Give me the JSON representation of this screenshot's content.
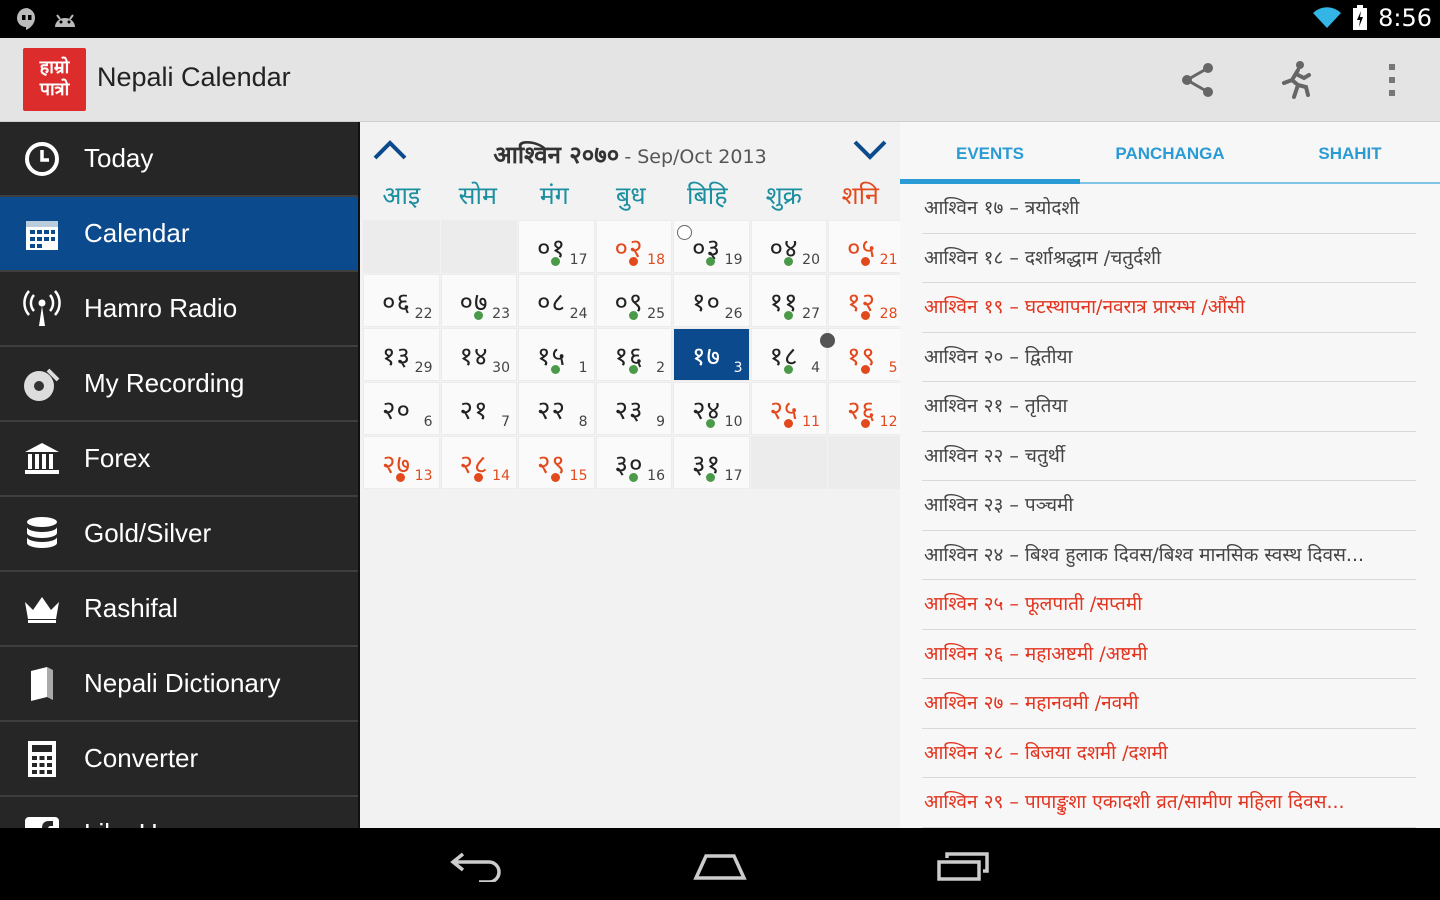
{
  "status": {
    "time": "8:56"
  },
  "app": {
    "title": "Nepali Calendar",
    "logo_line1": "हाम्रो",
    "logo_line2": "पात्रो"
  },
  "sidebar": {
    "items": [
      {
        "label": "Today",
        "icon": "clock-icon"
      },
      {
        "label": "Calendar",
        "icon": "calendar-icon",
        "active": true
      },
      {
        "label": "Hamro Radio",
        "icon": "radio-antenna-icon"
      },
      {
        "label": "My Recording",
        "icon": "record-icon"
      },
      {
        "label": "Forex",
        "icon": "bank-icon"
      },
      {
        "label": "Gold/Silver",
        "icon": "coin-stack-icon"
      },
      {
        "label": "Rashifal",
        "icon": "crown-icon"
      },
      {
        "label": "Nepali Dictionary",
        "icon": "book-icon"
      },
      {
        "label": "Converter",
        "icon": "calculator-icon"
      },
      {
        "label": "Like Us",
        "icon": "facebook-icon"
      }
    ]
  },
  "calendar": {
    "month_np": "आश्विन २०७०",
    "month_en": "- Sep/Oct 2013",
    "weekdays": [
      "आइ",
      "सोम",
      "मंग",
      "बुध",
      "बिहि",
      "शुक्र",
      "शनि"
    ],
    "cells": [
      {
        "empty": true
      },
      {
        "empty": true
      },
      {
        "np": "०१",
        "en": "17",
        "dot": "green"
      },
      {
        "np": "०२",
        "en": "18",
        "dot": "red",
        "hol": true
      },
      {
        "np": "०३",
        "en": "19",
        "dot": "green",
        "moon": "new"
      },
      {
        "np": "०४",
        "en": "20",
        "dot": "green"
      },
      {
        "np": "०५",
        "en": "21",
        "dot": "red",
        "sat": true
      },
      {
        "np": "०६",
        "en": "22"
      },
      {
        "np": "०७",
        "en": "23",
        "dot": "green"
      },
      {
        "np": "०८",
        "en": "24"
      },
      {
        "np": "०९",
        "en": "25",
        "dot": "green"
      },
      {
        "np": "१०",
        "en": "26"
      },
      {
        "np": "११",
        "en": "27",
        "dot": "green"
      },
      {
        "np": "१२",
        "en": "28",
        "dot": "red",
        "sat": true
      },
      {
        "np": "१३",
        "en": "29"
      },
      {
        "np": "१४",
        "en": "30"
      },
      {
        "np": "१५",
        "en": "1",
        "dot": "green"
      },
      {
        "np": "१६",
        "en": "2",
        "dot": "green"
      },
      {
        "np": "१७",
        "en": "3",
        "today": true
      },
      {
        "np": "१८",
        "en": "4",
        "dot": "green"
      },
      {
        "np": "१९",
        "en": "5",
        "dot": "red",
        "sat": true,
        "moon": "full"
      },
      {
        "np": "२०",
        "en": "6"
      },
      {
        "np": "२१",
        "en": "7"
      },
      {
        "np": "२२",
        "en": "8"
      },
      {
        "np": "२३",
        "en": "9"
      },
      {
        "np": "२४",
        "en": "10",
        "dot": "green"
      },
      {
        "np": "२५",
        "en": "11",
        "dot": "red",
        "hol": true
      },
      {
        "np": "२६",
        "en": "12",
        "dot": "red",
        "sat": true
      },
      {
        "np": "२७",
        "en": "13",
        "dot": "red",
        "hol": true
      },
      {
        "np": "२८",
        "en": "14",
        "dot": "red",
        "hol": true
      },
      {
        "np": "२९",
        "en": "15",
        "dot": "red",
        "hol": true
      },
      {
        "np": "३०",
        "en": "16",
        "dot": "green"
      },
      {
        "np": "३१",
        "en": "17",
        "dot": "green"
      },
      {
        "empty": true
      },
      {
        "empty": true
      }
    ]
  },
  "tabs": [
    "EVENTS",
    "PANCHANGA",
    "SHAHIT"
  ],
  "events": [
    {
      "text": "आश्विन १७ – त्रयोदशी",
      "red": false
    },
    {
      "text": "आश्विन १८ – दर्शाश्रद्धाम /चतुर्दशी",
      "red": false
    },
    {
      "text": "आश्विन १९ – घटस्थापना/नवरात्र प्रारम्भ /औंसी",
      "red": true
    },
    {
      "text": "आश्विन २० – द्वितीया",
      "red": false
    },
    {
      "text": "आश्विन २१ – तृतिया",
      "red": false
    },
    {
      "text": "आश्विन २२ – चतुर्थी",
      "red": false
    },
    {
      "text": "आश्विन २३ – पञ्चमी",
      "red": false
    },
    {
      "text": "आश्विन २४ – बिश्व हुलाक दिवस/बिश्व मानसिक स्वस्थ दिवस...",
      "red": false
    },
    {
      "text": "आश्विन २५ – फूलपाती /सप्तमी",
      "red": true
    },
    {
      "text": "आश्विन २६ – महाअष्टमी /अष्टमी",
      "red": true
    },
    {
      "text": "आश्विन २७ – महानवमी /नवमी",
      "red": true
    },
    {
      "text": "आश्विन २८ – बिजया दशमी /दशमी",
      "red": true
    },
    {
      "text": "आश्विन २९ – पापाङ्कुशा एकादशी व्रत/सामीण महिला दिवस...",
      "red": true
    }
  ],
  "colors": {
    "accent": "#0b4a8c",
    "tab": "#2a9bd4",
    "holiday": "#e24a1e",
    "weekday": "#1b8ea0"
  }
}
